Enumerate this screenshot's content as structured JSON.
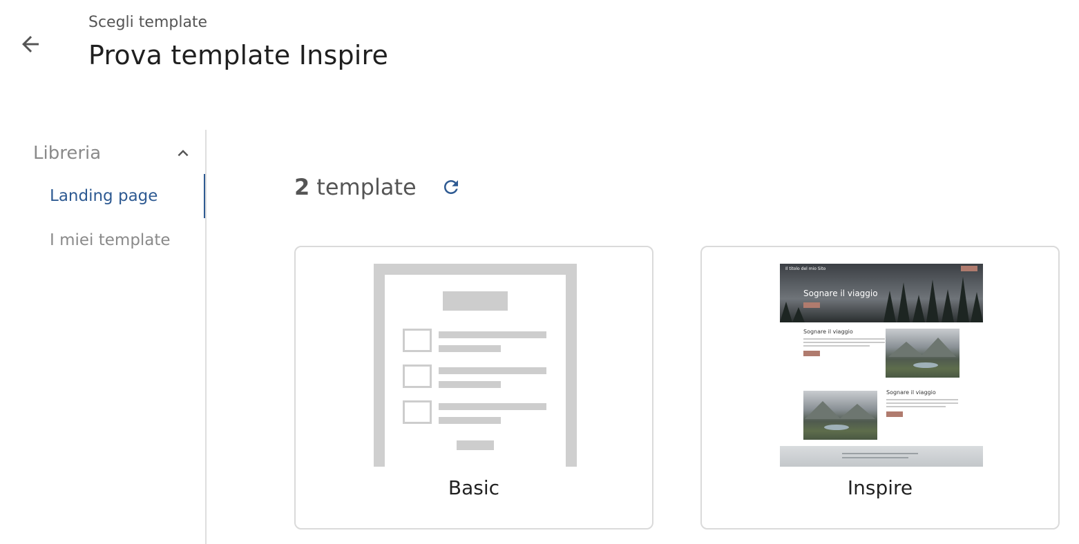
{
  "header": {
    "back_icon": "arrow-left-icon",
    "eyebrow": "Scegli template",
    "title": "Prova template Inspire"
  },
  "sidebar": {
    "section_label": "Libreria",
    "section_icon": "chevron-up-icon",
    "items": [
      {
        "label": "Landing page",
        "active": true
      },
      {
        "label": "I miei template",
        "active": false
      }
    ]
  },
  "main": {
    "count": "2",
    "count_label": "template",
    "refresh_icon": "refresh-icon",
    "cards": [
      {
        "label": "Basic"
      },
      {
        "label": "Inspire",
        "thumbnail": {
          "site_title": "Il titolo del mio Sito",
          "hero_heading": "Sognare il viaggio",
          "section_heading_1": "Sognare il viaggio",
          "section_heading_2": "Sognare il viaggio"
        }
      }
    ]
  },
  "colors": {
    "accent": "#2e5a92",
    "button_thumb": "#b07b6e"
  }
}
